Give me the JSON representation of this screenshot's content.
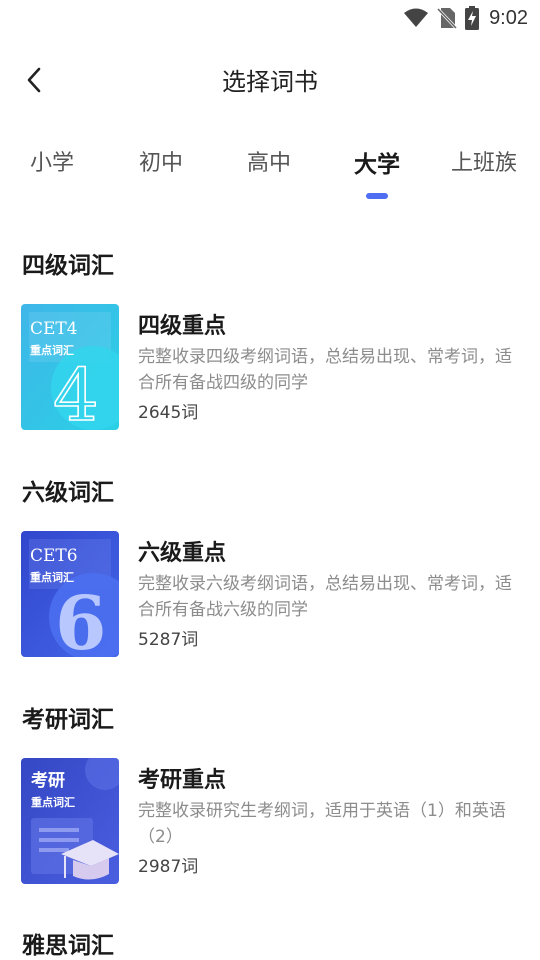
{
  "status": {
    "time": "9:02"
  },
  "nav": {
    "title": "选择词书"
  },
  "tabs": [
    {
      "label": "小学"
    },
    {
      "label": "初中"
    },
    {
      "label": "高中"
    },
    {
      "label": "大学"
    },
    {
      "label": "上班族"
    }
  ],
  "active_tab_index": 3,
  "sections": [
    {
      "title": "四级词汇",
      "book": {
        "name": "四级重点",
        "desc": "完整收录四级考纲词语，总结易出现、常考词，适合所有备战四级的同学",
        "count": "2645词",
        "cover_title": "CET4",
        "cover_sub": "重点词汇",
        "cover_numeral": "4",
        "cover_color": "#2fc0e6"
      }
    },
    {
      "title": "六级词汇",
      "book": {
        "name": "六级重点",
        "desc": "完整收录六级考纲词语，总结易出现、常考词，适合所有备战六级的同学",
        "count": "5287词",
        "cover_title": "CET6",
        "cover_sub": "重点词汇",
        "cover_numeral": "6",
        "cover_color": "#3a52d6"
      }
    },
    {
      "title": "考研词汇",
      "book": {
        "name": "考研重点",
        "desc": "完整收录研究生考纲词，适用于英语（1）和英语（2）",
        "count": "2987词",
        "cover_title": "考研",
        "cover_sub": "重点词汇",
        "cover_color": "#3f4fd0"
      }
    },
    {
      "title": "雅思词汇"
    }
  ],
  "colors": {
    "accent": "#4f6ef2",
    "text_primary": "#1a1a1a",
    "text_secondary": "#8c8c8c"
  },
  "icons": {
    "back": "chevron-left-icon",
    "wifi": "wifi-icon",
    "sim": "no-sim-icon",
    "battery": "battery-charging-icon"
  }
}
